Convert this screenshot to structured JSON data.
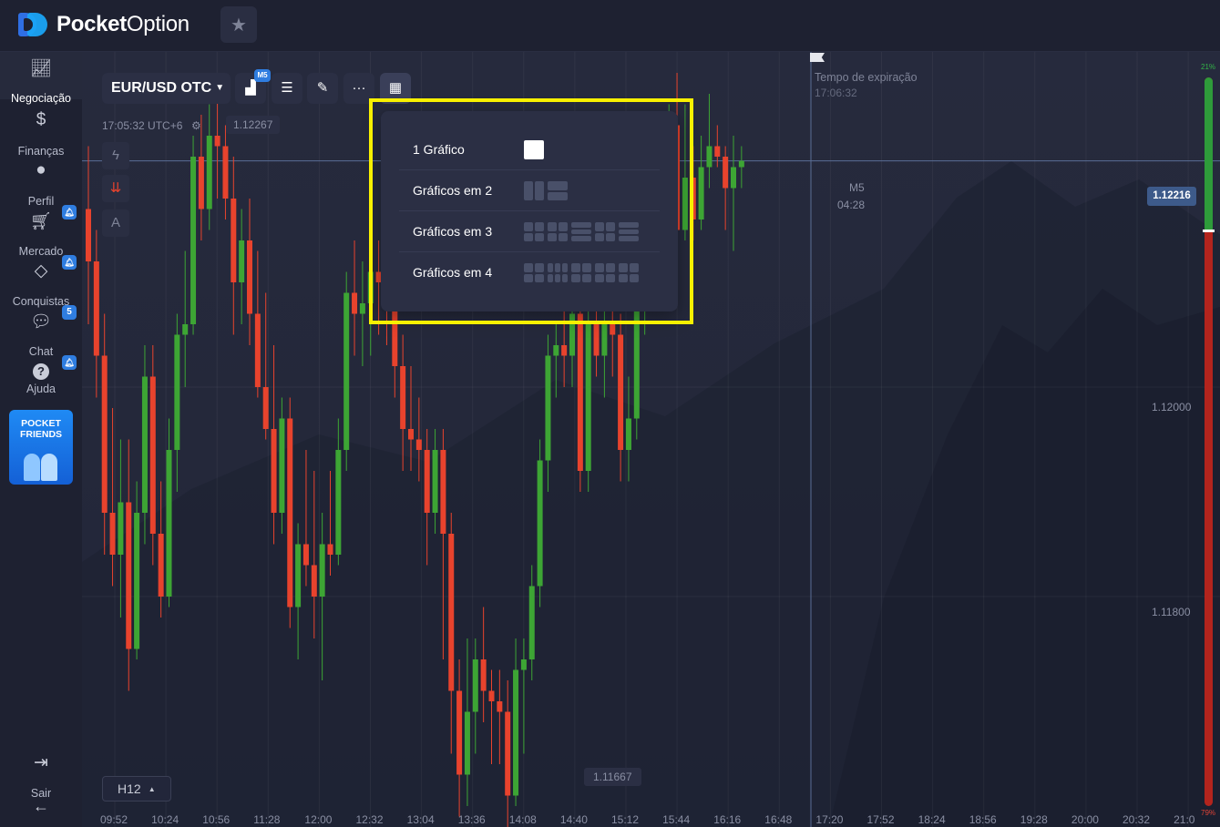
{
  "app": {
    "logo_bold": "Pocket",
    "logo_regular": "Option"
  },
  "sidebar": {
    "items": [
      {
        "label": "Negociação",
        "icon": "chart-line-icon",
        "active": true
      },
      {
        "label": "Finanças",
        "icon": "dollar-icon"
      },
      {
        "label": "Perfil",
        "icon": "user-icon"
      },
      {
        "label": "Mercado",
        "icon": "cart-icon",
        "badge": "bell"
      },
      {
        "label": "Conquistas",
        "icon": "diamond-icon",
        "badge": "bell"
      },
      {
        "label": "Chat",
        "icon": "chat-icon",
        "badge": "5"
      },
      {
        "label": "Ajuda",
        "icon": "help-icon",
        "badge": "bell"
      }
    ],
    "promo_line1": "POCKET",
    "promo_line2": "FRIENDS",
    "logout_label": "Sair"
  },
  "toolbar": {
    "pair": "EUR/USD OTC",
    "timeframe_badge": "M5"
  },
  "chart_info": {
    "server_time": "17:05:32 UTC+6",
    "high_price": "1.12267",
    "low_price": "1.11667",
    "expiration_label": "Tempo de expiração",
    "expiration_time": "17:06:32",
    "candle_timeframe": "M5",
    "countdown": "04:28",
    "current_price": "1.12216",
    "y_ticks": [
      "1.12000",
      "1.11800"
    ],
    "x_ticks": [
      "09:52",
      "10:24",
      "10:56",
      "11:28",
      "12:00",
      "12:32",
      "13:04",
      "13:36",
      "14:08",
      "14:40",
      "15:12",
      "15:44",
      "16:16",
      "16:48",
      "17:20",
      "17:52",
      "18:24",
      "18:56",
      "19:28",
      "20:00",
      "20:32",
      "21:0"
    ],
    "timeframe_button": "H12"
  },
  "sentiment": {
    "up_percent": "21%",
    "down_percent": "79%",
    "up_value": 21,
    "colors": {
      "up": "#2e9b3a",
      "down": "#b3241d"
    }
  },
  "layout_menu": {
    "rows": [
      {
        "label": "1 Gráfico",
        "options": [
          [
            1,
            1
          ]
        ]
      },
      {
        "label": "Gráficos em 2",
        "options": [
          [
            1,
            2
          ],
          [
            2,
            1
          ]
        ]
      },
      {
        "label": "Gráficos em 3",
        "options": [
          [
            2,
            2
          ],
          [
            2,
            2
          ],
          [
            3,
            1
          ],
          [
            2,
            2
          ],
          [
            3,
            1
          ]
        ]
      },
      {
        "label": "Gráficos em 4",
        "options": [
          [
            2,
            2
          ],
          [
            2,
            3
          ],
          [
            2,
            2
          ],
          [
            2,
            2
          ],
          [
            2,
            2
          ]
        ]
      }
    ]
  },
  "chart_data": {
    "type": "candlestick",
    "y_range": [
      1.1158,
      1.1232
    ],
    "colors": {
      "up": "#3da534",
      "down": "#e8432d"
    },
    "candles": [
      [
        1.1217,
        1.1223,
        1.1206,
        1.1212
      ],
      [
        1.1212,
        1.1215,
        1.1199,
        1.1203
      ],
      [
        1.1203,
        1.1207,
        1.1184,
        1.1188
      ],
      [
        1.1188,
        1.1198,
        1.1181,
        1.1184
      ],
      [
        1.1184,
        1.1195,
        1.1178,
        1.1189
      ],
      [
        1.1189,
        1.1195,
        1.1171,
        1.1175
      ],
      [
        1.1175,
        1.1191,
        1.1174,
        1.1188
      ],
      [
        1.1188,
        1.1204,
        1.1185,
        1.1201
      ],
      [
        1.1201,
        1.1204,
        1.1183,
        1.1186
      ],
      [
        1.1186,
        1.1191,
        1.1178,
        1.118
      ],
      [
        1.118,
        1.1197,
        1.1179,
        1.1194
      ],
      [
        1.1194,
        1.1207,
        1.119,
        1.1205
      ],
      [
        1.1205,
        1.1213,
        1.12,
        1.1206
      ],
      [
        1.1206,
        1.1224,
        1.1205,
        1.1222
      ],
      [
        1.1222,
        1.1226,
        1.1214,
        1.1217
      ],
      [
        1.1217,
        1.1227,
        1.1215,
        1.1224
      ],
      [
        1.1224,
        1.1228,
        1.1218,
        1.1223
      ],
      [
        1.1223,
        1.1225,
        1.1216,
        1.1218
      ],
      [
        1.1218,
        1.1222,
        1.1205,
        1.121
      ],
      [
        1.121,
        1.1217,
        1.1206,
        1.1214
      ],
      [
        1.1214,
        1.1218,
        1.1204,
        1.1207
      ],
      [
        1.1207,
        1.1213,
        1.1199,
        1.12
      ],
      [
        1.12,
        1.1209,
        1.1195,
        1.1196
      ],
      [
        1.1196,
        1.1204,
        1.1185,
        1.1188
      ],
      [
        1.1188,
        1.1199,
        1.1186,
        1.1197
      ],
      [
        1.1197,
        1.1199,
        1.1177,
        1.1179
      ],
      [
        1.1179,
        1.1187,
        1.1174,
        1.1185
      ],
      [
        1.1185,
        1.1194,
        1.1181,
        1.1183
      ],
      [
        1.1183,
        1.1192,
        1.1176,
        1.118
      ],
      [
        1.118,
        1.1188,
        1.1172,
        1.1185
      ],
      [
        1.1185,
        1.1192,
        1.1182,
        1.1184
      ],
      [
        1.1184,
        1.1197,
        1.1183,
        1.1194
      ],
      [
        1.1194,
        1.1211,
        1.1192,
        1.1209
      ],
      [
        1.1209,
        1.1214,
        1.1203,
        1.1207
      ],
      [
        1.1207,
        1.1212,
        1.1202,
        1.1208
      ],
      [
        1.1208,
        1.1215,
        1.1203,
        1.1211
      ],
      [
        1.1211,
        1.1214,
        1.1205,
        1.121
      ],
      [
        1.121,
        1.1217,
        1.1204,
        1.1208
      ],
      [
        1.1208,
        1.1211,
        1.1199,
        1.1202
      ],
      [
        1.1202,
        1.1205,
        1.1192,
        1.1196
      ],
      [
        1.1196,
        1.1202,
        1.1192,
        1.1195
      ],
      [
        1.1195,
        1.1199,
        1.1191,
        1.1194
      ],
      [
        1.1194,
        1.1196,
        1.1183,
        1.1188
      ],
      [
        1.1188,
        1.1196,
        1.1186,
        1.1194
      ],
      [
        1.1194,
        1.1196,
        1.1174,
        1.1186
      ],
      [
        1.1186,
        1.1188,
        1.1165,
        1.1171
      ],
      [
        1.1171,
        1.1174,
        1.1159,
        1.1163
      ],
      [
        1.1163,
        1.1176,
        1.116,
        1.1169
      ],
      [
        1.1169,
        1.1176,
        1.1165,
        1.1174
      ],
      [
        1.1174,
        1.1179,
        1.1168,
        1.1171
      ],
      [
        1.1171,
        1.1173,
        1.1164,
        1.117
      ],
      [
        1.117,
        1.1173,
        1.1164,
        1.1169
      ],
      [
        1.1169,
        1.1172,
        1.1156,
        1.1161
      ],
      [
        1.1161,
        1.1176,
        1.116,
        1.1173
      ],
      [
        1.1173,
        1.1176,
        1.1165,
        1.1174
      ],
      [
        1.1174,
        1.1183,
        1.1172,
        1.1181
      ],
      [
        1.1181,
        1.1195,
        1.1179,
        1.1193
      ],
      [
        1.1193,
        1.1205,
        1.119,
        1.1203
      ],
      [
        1.1203,
        1.1206,
        1.1199,
        1.1204
      ],
      [
        1.1204,
        1.1208,
        1.12,
        1.1203
      ],
      [
        1.1203,
        1.121,
        1.12,
        1.1207
      ],
      [
        1.1207,
        1.121,
        1.119,
        1.1192
      ],
      [
        1.1192,
        1.121,
        1.119,
        1.1206
      ],
      [
        1.1206,
        1.1208,
        1.1201,
        1.1203
      ],
      [
        1.1203,
        1.1208,
        1.1199,
        1.1206
      ],
      [
        1.1206,
        1.1209,
        1.1201,
        1.1205
      ],
      [
        1.1205,
        1.1207,
        1.1191,
        1.1194
      ],
      [
        1.1194,
        1.1201,
        1.1191,
        1.1197
      ],
      [
        1.1197,
        1.1211,
        1.1195,
        1.1208
      ],
      [
        1.1208,
        1.1214,
        1.1205,
        1.1211
      ],
      [
        1.1211,
        1.1218,
        1.1208,
        1.1216
      ],
      [
        1.1216,
        1.1223,
        1.1214,
        1.122
      ],
      [
        1.122,
        1.1227,
        1.1219,
        1.1225
      ],
      [
        1.1225,
        1.123,
        1.1213,
        1.1215
      ],
      [
        1.1215,
        1.1227,
        1.1214,
        1.122
      ],
      [
        1.122,
        1.1223,
        1.1214,
        1.1216
      ],
      [
        1.1216,
        1.1224,
        1.1215,
        1.1221
      ],
      [
        1.1221,
        1.1228,
        1.1219,
        1.1223
      ],
      [
        1.1223,
        1.1225,
        1.1221,
        1.1222
      ],
      [
        1.1222,
        1.1223,
        1.1215,
        1.1219
      ],
      [
        1.1219,
        1.1224,
        1.1213,
        1.1221
      ],
      [
        1.1221,
        1.1223,
        1.1219,
        1.12216
      ]
    ]
  }
}
